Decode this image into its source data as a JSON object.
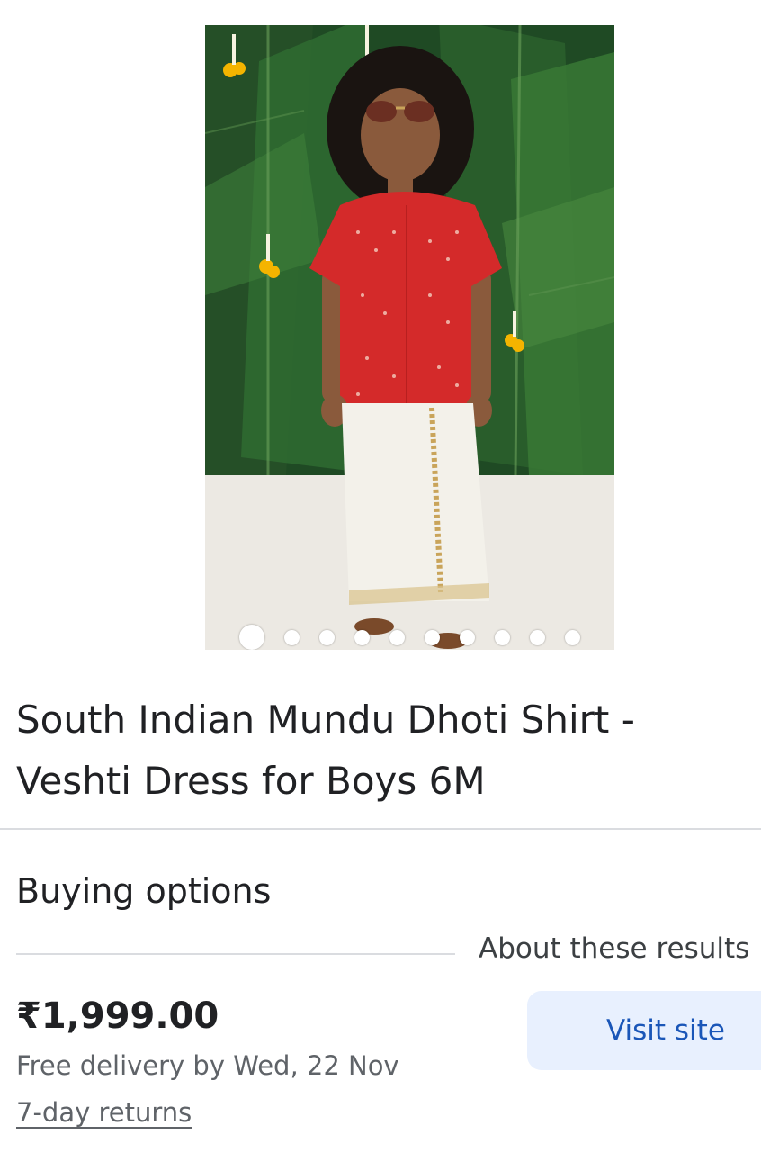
{
  "product": {
    "title_line1": "South Indian Mundu Dhoti Shirt -",
    "title_line2": "Veshti Dress for Boys 6M",
    "image": {
      "image_count": 10,
      "active_index": 0
    }
  },
  "buying_options": {
    "heading": "Buying options",
    "about_results": "About these results",
    "offer": {
      "price": "₹1,999.00",
      "delivery": "Free delivery by Wed, 22 Nov",
      "returns": "7-day returns",
      "visit_label": "Visit site"
    }
  },
  "colors": {
    "leaf_dark": "#1f4a24",
    "leaf_mid": "#2f6b31",
    "shirt_red": "#d42a2a",
    "dhoti_white": "#f3f1ea",
    "marigold": "#f4b400",
    "link_blue": "#1a56b8",
    "button_bg": "#e8f0fe"
  }
}
